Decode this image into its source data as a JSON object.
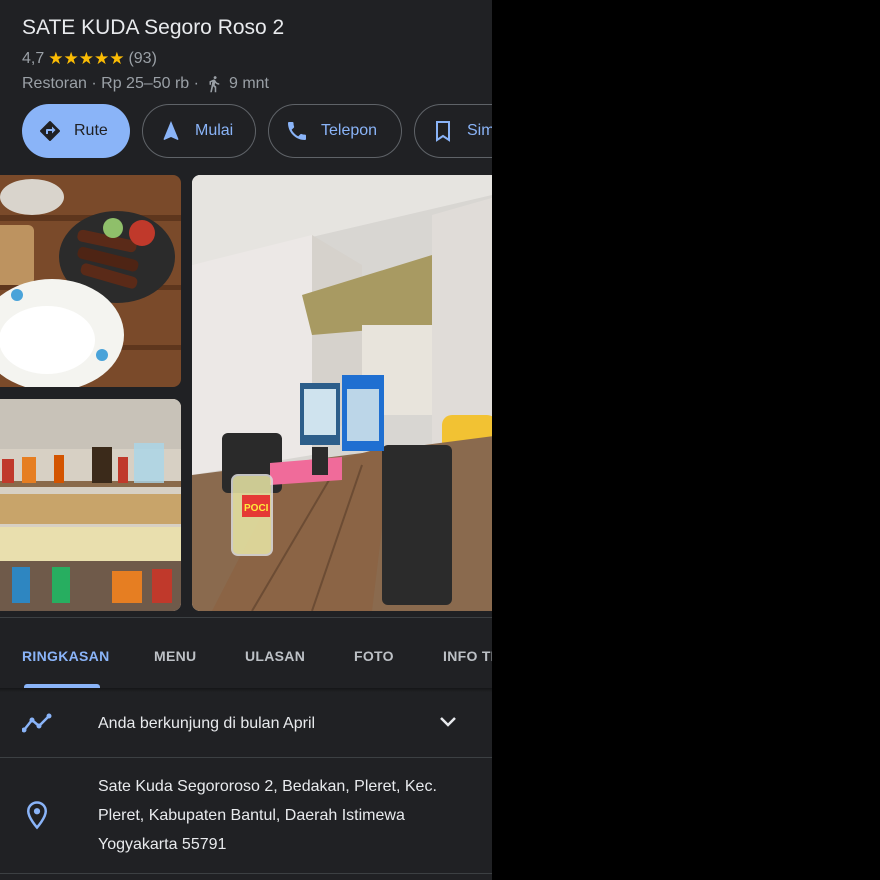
{
  "place": {
    "name": "SATE KUDA Segoro Roso 2",
    "rating": "4,7",
    "stars": "★★★★★",
    "review_count": "(93)",
    "meta": "Restoran · Rp 25–50 rb ·",
    "walk_time": "9 mnt"
  },
  "actions": [
    {
      "label": "Rute",
      "icon": "directions-icon"
    },
    {
      "label": "Mulai",
      "icon": "navigation-icon"
    },
    {
      "label": "Telepon",
      "icon": "phone-icon"
    },
    {
      "label": "Sim",
      "icon": "bookmark-icon"
    }
  ],
  "tabs": [
    "RINGKASAN",
    "MENU",
    "ULASAN",
    "FOTO",
    "INFO TI"
  ],
  "visit": {
    "text": "Anda berkunjung di bulan April"
  },
  "address": {
    "line1": "Sate Kuda Segororoso 2, Bedakan, Pleret, Kec.",
    "line2": "Pleret, Kabupaten Bantul, Daerah Istimewa",
    "line3": "Yogyakarta 55791"
  },
  "photo_text": {
    "cup_label": "POCI"
  },
  "colors": {
    "panel_bg": "#202124",
    "accent": "#8ab4f8",
    "star": "#fbbc04",
    "muted": "#9aa0a6"
  }
}
